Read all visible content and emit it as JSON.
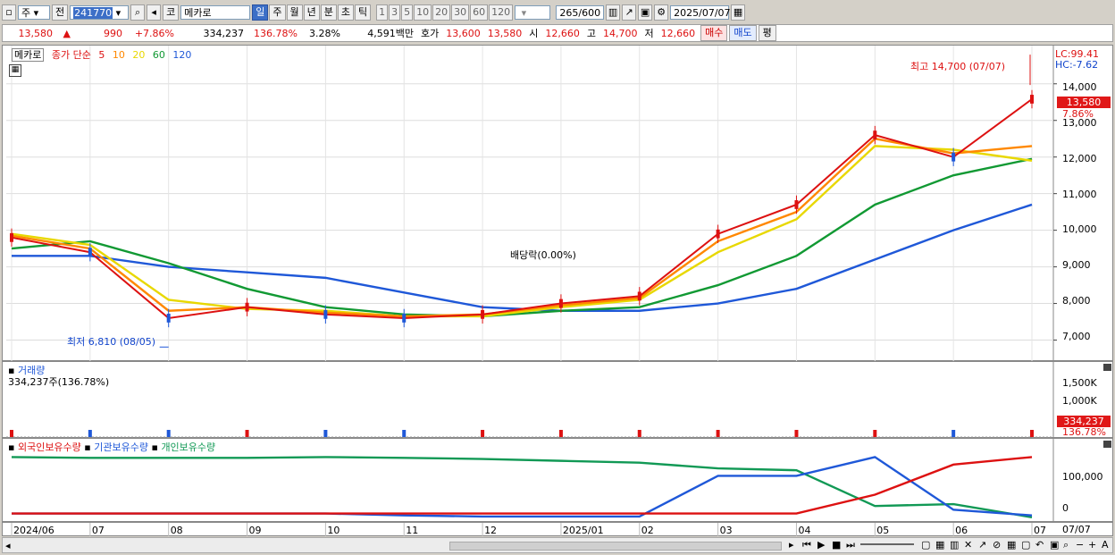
{
  "toolbar": {
    "type_label": "주",
    "prev_label": "전",
    "code": "241770",
    "market_label": "코",
    "name": "메카로",
    "periods": [
      "일",
      "주",
      "월",
      "년",
      "분",
      "초",
      "틱"
    ],
    "selected_period": "일",
    "intervals": [
      "1",
      "3",
      "5",
      "10",
      "20",
      "30",
      "60",
      "120"
    ],
    "count": "265",
    "count_total": "/600",
    "date": "2025/07/07"
  },
  "info": {
    "price": "13,580",
    "change_mark": "▲",
    "change": "990",
    "change_pct": "+7.86%",
    "volume": "334,237",
    "volume_ratio": "136.78%",
    "turnover": "3.28%",
    "amount": "4,591백만",
    "quote_label": "호가",
    "ask": "13,600",
    "bid": "13,580",
    "open_label": "시",
    "open": "12,660",
    "high_label": "고",
    "high": "14,700",
    "low_label": "저",
    "low": "12,660",
    "buy_label": "매수",
    "sell_label": "매도",
    "eval_label": "평"
  },
  "price_panel": {
    "name_tag": "메카로",
    "legend_label": "종가 단순",
    "ma_periods": [
      {
        "label": "5",
        "color": "#dd1111"
      },
      {
        "label": "10",
        "color": "#ff8800"
      },
      {
        "label": "20",
        "color": "#e8d800"
      },
      {
        "label": "60",
        "color": "#119933"
      },
      {
        "label": "120",
        "color": "#1f58d8"
      }
    ],
    "lc": "LC:99.41",
    "hc": "HC:-7.62",
    "high_annot": "최고 14,700 (07/07)",
    "low_annot": "최저 6,810 (08/05)",
    "dividend_annot": "배당락(0.00%)",
    "current_price": "13,580",
    "current_pct": "7.86%",
    "y_ticks": [
      "14,000",
      "13,000",
      "12,000",
      "11,000",
      "10,000",
      "9,000",
      "8,000",
      "7,000"
    ]
  },
  "volume_panel": {
    "title": "거래량",
    "subtitle": "334,237주(136.78%)",
    "y_ticks": [
      "1,500K",
      "1,000K"
    ],
    "current": "334,237",
    "current_pct": "136.78%"
  },
  "holdings_panel": {
    "legends": [
      {
        "label": "외국인보유수량",
        "color": "#dd1111"
      },
      {
        "label": "기관보유수량",
        "color": "#1f58d8"
      },
      {
        "label": "개인보유수량",
        "color": "#119955"
      }
    ],
    "y_ticks": [
      "100,000",
      "0"
    ]
  },
  "x_axis": {
    "labels": [
      "2024/06",
      "07",
      "08",
      "09",
      "10",
      "11",
      "12",
      "2025/01",
      "02",
      "03",
      "04",
      "05",
      "06",
      "07"
    ],
    "right_label": "07/07"
  },
  "chart_data": {
    "type": "line",
    "x": [
      "2024/06",
      "07",
      "08",
      "09",
      "10",
      "11",
      "12",
      "2025/01",
      "02",
      "03",
      "04",
      "05",
      "06",
      "07"
    ],
    "series": [
      {
        "name": "5",
        "values": [
          9800,
          9400,
          7600,
          7900,
          7700,
          7600,
          7700,
          8000,
          8200,
          9900,
          10700,
          12600,
          12000,
          13580
        ]
      },
      {
        "name": "10",
        "values": [
          9850,
          9500,
          7800,
          7900,
          7750,
          7650,
          7700,
          7950,
          8150,
          9700,
          10500,
          12500,
          12100,
          12300
        ]
      },
      {
        "name": "20",
        "values": [
          9900,
          9600,
          8100,
          7850,
          7800,
          7650,
          7650,
          7900,
          8100,
          9400,
          10300,
          12300,
          12200,
          11900
        ]
      },
      {
        "name": "60",
        "values": [
          9500,
          9700,
          9100,
          8400,
          7900,
          7700,
          7650,
          7800,
          7900,
          8500,
          9300,
          10700,
          11500,
          11950
        ]
      },
      {
        "name": "120",
        "values": [
          9300,
          9300,
          9000,
          8850,
          8700,
          8300,
          7900,
          7800,
          7800,
          8000,
          8400,
          9200,
          10000,
          10700
        ]
      }
    ],
    "extremes": {
      "high": 14700,
      "high_date": "07/07",
      "low": 6810,
      "low_date": "08/05"
    },
    "ylim": [
      6500,
      14800
    ],
    "holdings": {
      "x": [
        "2024/06",
        "07",
        "08",
        "09",
        "10",
        "11",
        "12",
        "2025/01",
        "02",
        "03",
        "04",
        "05",
        "06",
        "07"
      ],
      "foreign": [
        0,
        0,
        0,
        0,
        0,
        0,
        0,
        0,
        0,
        0,
        0,
        50000,
        130000,
        150000
      ],
      "institution": [
        0,
        0,
        0,
        0,
        0,
        -5000,
        -8000,
        -8000,
        -8000,
        100000,
        100000,
        150000,
        10000,
        -5000
      ],
      "individual": [
        150000,
        148000,
        148000,
        148000,
        150000,
        148000,
        145000,
        140000,
        135000,
        120000,
        115000,
        20000,
        25000,
        -10000
      ]
    }
  }
}
